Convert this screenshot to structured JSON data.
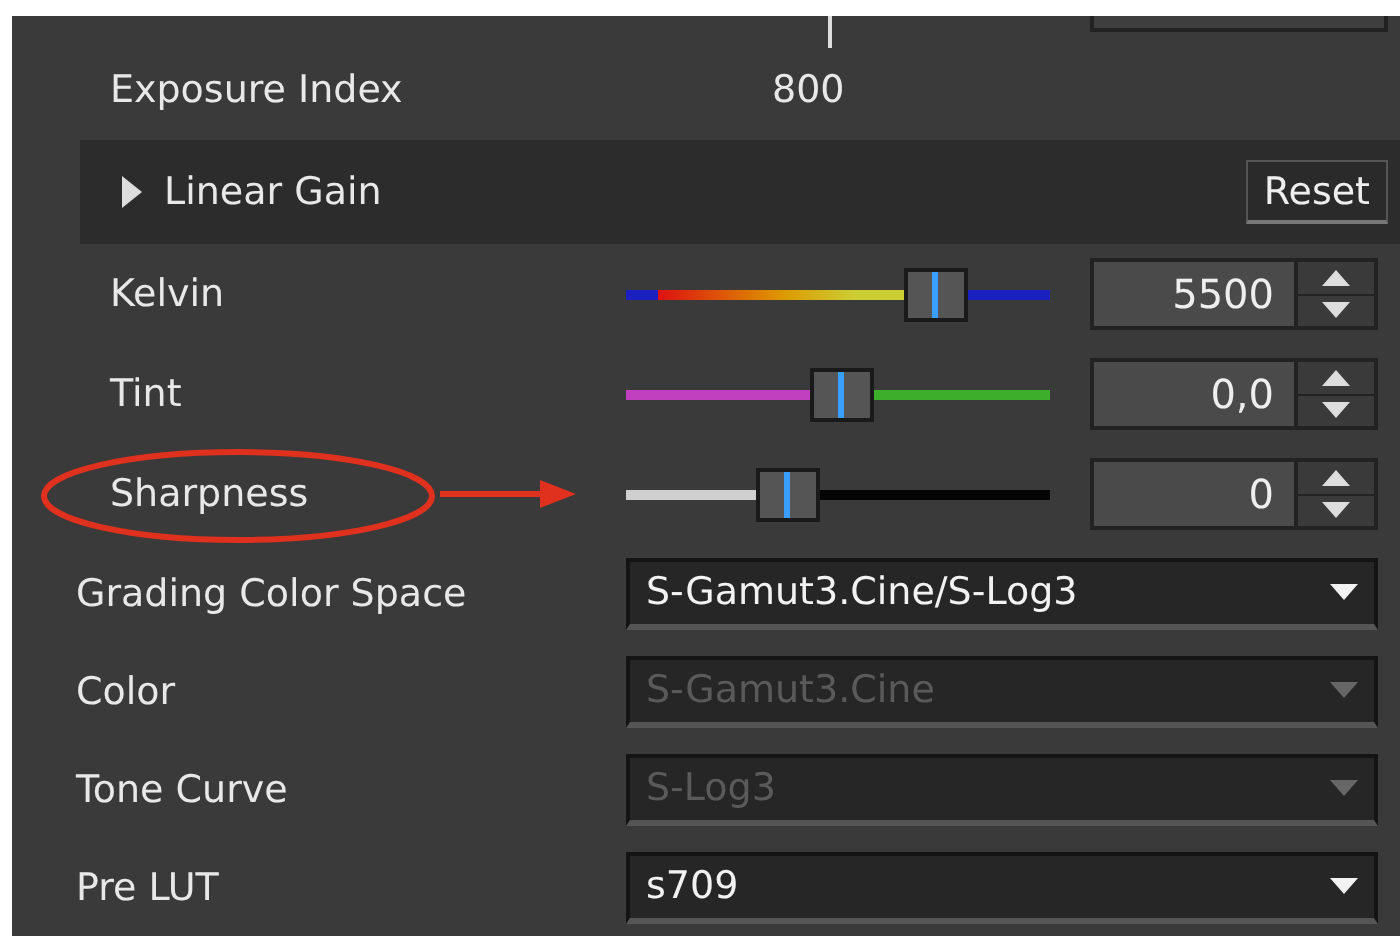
{
  "exposure_index": {
    "label": "Exposure Index",
    "value": "800"
  },
  "linear_gain": {
    "label": "Linear Gain",
    "expanded": false,
    "reset_button": "Reset"
  },
  "sliders": [
    {
      "label": "Kelvin",
      "kind": "temperature",
      "level": 0.77,
      "value": "5500",
      "highlighted": false
    },
    {
      "label": "Tint",
      "kind": "tint",
      "level": 0.51,
      "value": "0,0",
      "highlighted": false
    },
    {
      "label": "Sharpness",
      "kind": "plain",
      "level": 0.36,
      "value": "0",
      "highlighted": true
    }
  ],
  "dropdowns": [
    {
      "label": "Grading Color Space",
      "value": "S-Gamut3.Cine/S-Log3",
      "disabled": false
    },
    {
      "label": "Color",
      "value": "S-Gamut3.Cine",
      "disabled": true
    },
    {
      "label": "Tone Curve",
      "value": "S-Log3",
      "disabled": true
    },
    {
      "label": "Pre LUT",
      "value": "s709",
      "disabled": false
    }
  ]
}
